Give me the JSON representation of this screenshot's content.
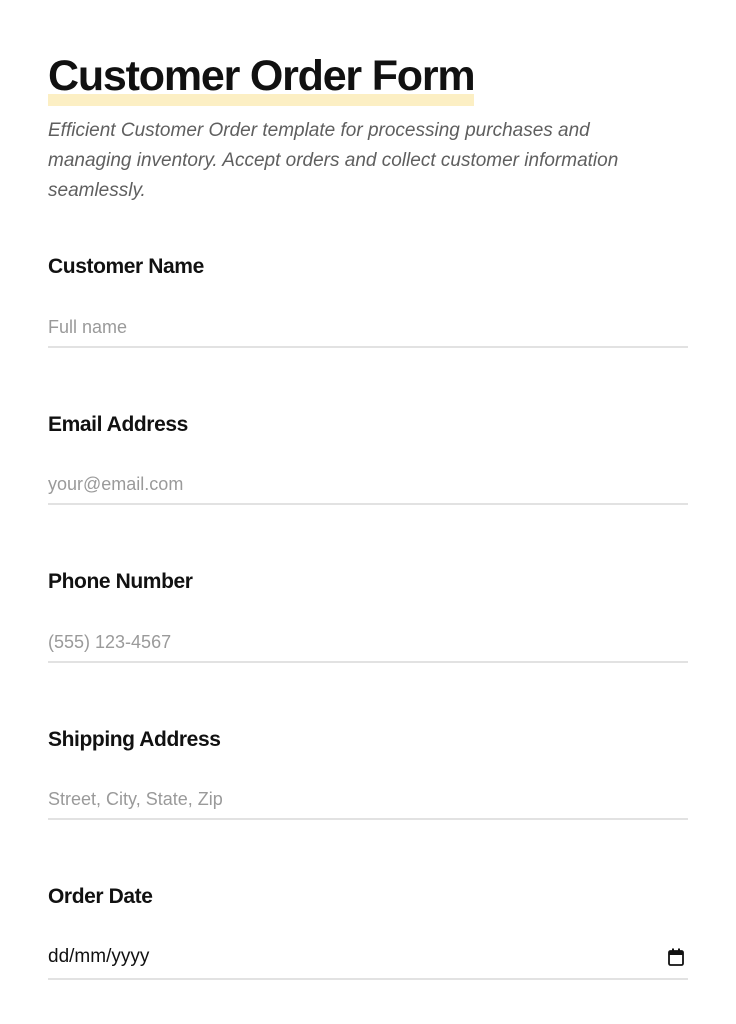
{
  "form": {
    "title": "Customer Order Form",
    "description": "Efficient Customer Order template for processing purchases and managing inventory. Accept orders and collect customer information seamlessly.",
    "accent_highlight": "#fcefc4"
  },
  "fields": {
    "customer_name": {
      "label": "Customer Name",
      "placeholder": "Full name",
      "value": ""
    },
    "email": {
      "label": "Email Address",
      "placeholder": "your@email.com",
      "value": ""
    },
    "phone": {
      "label": "Phone Number",
      "placeholder": "(555) 123-4567",
      "value": ""
    },
    "shipping_address": {
      "label": "Shipping Address",
      "placeholder": "Street, City, State, Zip",
      "value": ""
    },
    "order_date": {
      "label": "Order Date",
      "display_value": "dd/mm/yyyy",
      "icon": "calendar-icon"
    }
  }
}
